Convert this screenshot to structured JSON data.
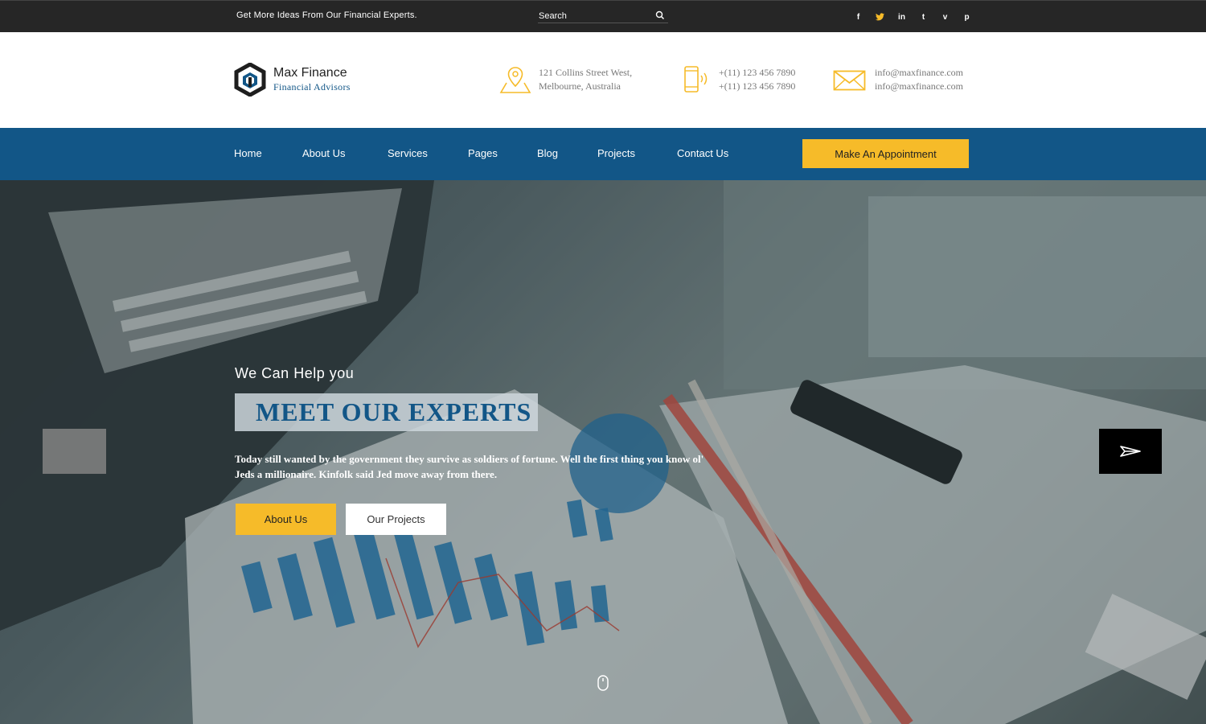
{
  "topbar": {
    "tagline": "Get More Ideas From Our Financial Experts.",
    "search_placeholder": "Search",
    "socials": [
      {
        "icon": "facebook-icon",
        "glyph": "f"
      },
      {
        "icon": "twitter-icon",
        "glyph": "🐦"
      },
      {
        "icon": "linkedin-icon",
        "glyph": "in"
      },
      {
        "icon": "tumblr-icon",
        "glyph": "t"
      },
      {
        "icon": "vimeo-icon",
        "glyph": "v"
      },
      {
        "icon": "pinterest-icon",
        "glyph": "p"
      }
    ]
  },
  "header": {
    "brand_name": "Max Finance",
    "brand_sub": "Financial Advisors",
    "address_line1": "121 Collins Street West,",
    "address_line2": "Melbourne, Australia",
    "phone_line1": "+(11) 123 456 7890",
    "phone_line2": "+(11) 123 456 7890",
    "email_line1": "info@maxfinance.com",
    "email_line2": "info@maxfinance.com"
  },
  "nav": {
    "items": [
      "Home",
      "About Us",
      "Services",
      "Pages",
      "Blog",
      "Projects",
      "Contact Us"
    ],
    "cta": "Make An Appointment"
  },
  "hero": {
    "kicker": "We Can Help you",
    "title": "MEET OUR EXPERTS",
    "text": "Today still wanted by the government they survive as soldiers of fortune. Well the first thing you know ol' Jeds a millionaire. Kinfolk said Jed move away from there.",
    "btn_primary": "About Us",
    "btn_secondary": "Our Projects"
  },
  "colors": {
    "brand_blue": "#125687",
    "accent_yellow": "#f6bb29",
    "topbar_bg": "#262626"
  }
}
